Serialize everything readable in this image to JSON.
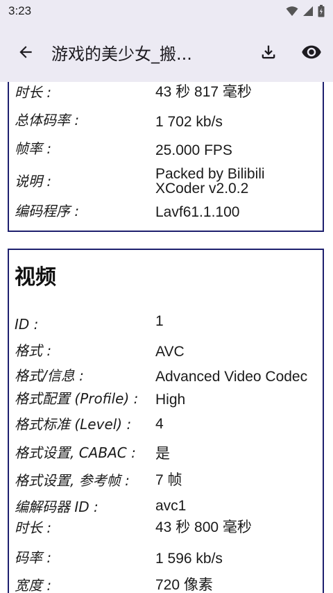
{
  "status_bar": {
    "time": "3:23",
    "icons": [
      "wifi-icon",
      "signal-icon",
      "battery-icon"
    ]
  },
  "app_bar": {
    "title": "游戏的美少女_搬...",
    "back_icon": "arrow-back-icon",
    "download_icon": "download-icon",
    "view_icon": "eye-icon"
  },
  "general_section": {
    "rows": [
      {
        "key": "时长 :",
        "value": "43 秒 817 毫秒"
      },
      {
        "key": "总体码率 :",
        "value": "1 702 kb/s"
      },
      {
        "key": "帧率 :",
        "value": "25.000 FPS"
      },
      {
        "key": "说明 :",
        "value_line1": "Packed by Bilibili",
        "value_line2": "XCoder v2.0.2"
      },
      {
        "key": "编码程序 :",
        "value": "Lavf61.1.100"
      }
    ]
  },
  "video_section": {
    "title": "视频",
    "rows": [
      {
        "key": "ID :",
        "value": "1"
      },
      {
        "key": "格式 :",
        "value": "AVC"
      },
      {
        "key": "格式/信息 :",
        "value": "Advanced Video Codec"
      },
      {
        "key": "格式配置 (Profile) :",
        "value": "High"
      },
      {
        "key": "格式标准 (Level) :",
        "value": "4"
      },
      {
        "key": "格式设置, CABAC :",
        "value": "是"
      },
      {
        "key": "格式设置, 参考帧 :",
        "value": "7 帧"
      },
      {
        "key": "编解码器 ID :",
        "value": "avc1"
      },
      {
        "key": "时长 :",
        "value": "43 秒 800 毫秒"
      },
      {
        "key": "码率 :",
        "value": "1 596 kb/s"
      },
      {
        "key": "宽度 :",
        "value": "720 像素"
      }
    ]
  }
}
